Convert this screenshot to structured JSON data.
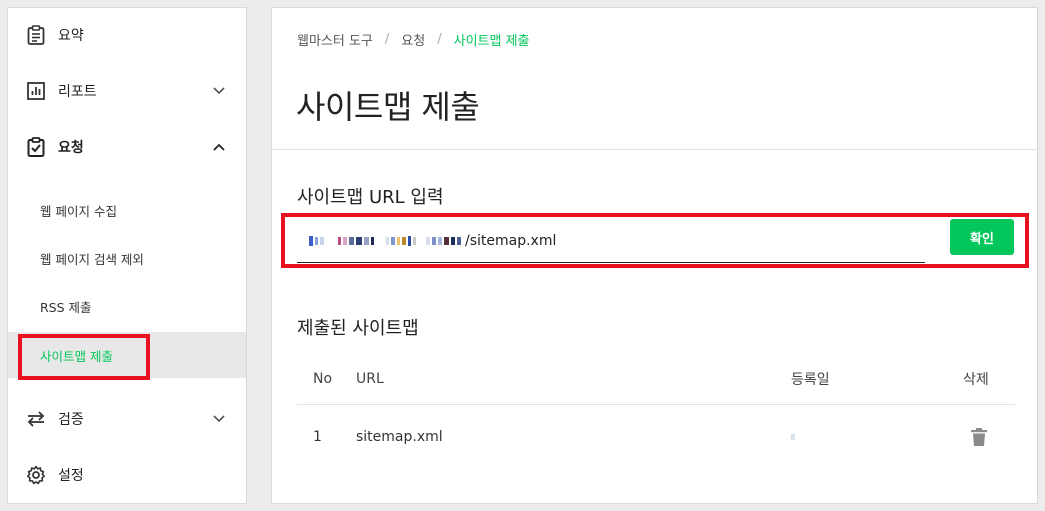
{
  "sidebar": {
    "items": [
      {
        "label": "요약",
        "icon": "clipboard-icon"
      },
      {
        "label": "리포트",
        "icon": "bar-chart-icon"
      },
      {
        "label": "요청",
        "icon": "clipboard-check-icon"
      },
      {
        "label": "검증",
        "icon": "swap-arrows-icon"
      },
      {
        "label": "설정",
        "icon": "gear-icon"
      }
    ],
    "sub_items": [
      {
        "label": "웹 페이지 수집"
      },
      {
        "label": "웹 페이지 검색 제외"
      },
      {
        "label": "RSS 제출"
      },
      {
        "label": "사이트맵 제출"
      }
    ]
  },
  "breadcrumb": {
    "items": [
      "웹마스터 도구",
      "요청",
      "사이트맵 제출"
    ],
    "separator": "/"
  },
  "page_title": "사이트맵 제출",
  "form": {
    "section_label": "사이트맵 URL 입력",
    "url_value": "/sitemap.xml",
    "confirm_label": "확인"
  },
  "list": {
    "section_label": "제출된 사이트맵",
    "columns": {
      "no": "No",
      "url": "URL",
      "date": "등록일",
      "delete": "삭제"
    },
    "rows": [
      {
        "no": "1",
        "url": "sitemap.xml"
      }
    ]
  },
  "colors": {
    "accent": "#03c75a",
    "highlight": "#e8111f",
    "active_bg": "#e8e8e8"
  }
}
